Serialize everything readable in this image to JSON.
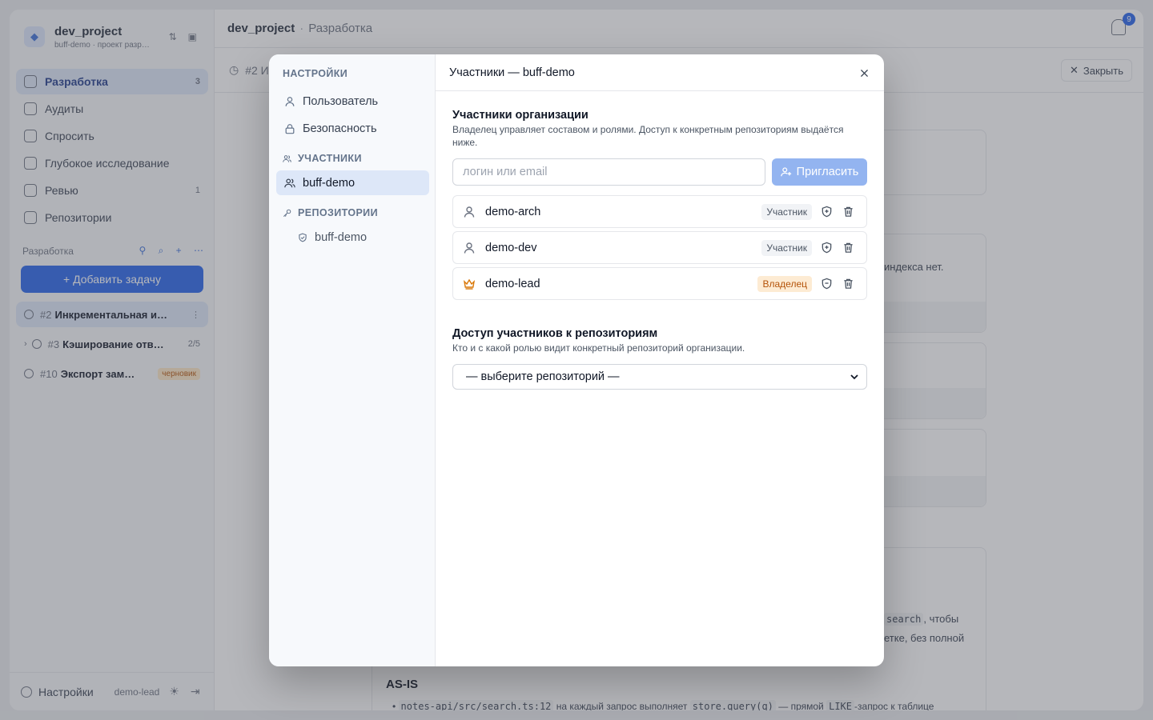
{
  "app": {
    "project_name": "dev_project",
    "project_sub": "buff-demo · проект разр…",
    "nav": [
      {
        "label": "Разработка",
        "count": "3"
      },
      {
        "label": "Аудиты",
        "count": ""
      },
      {
        "label": "Спросить",
        "count": ""
      },
      {
        "label": "Глубокое исследование",
        "count": ""
      },
      {
        "label": "Ревью",
        "count": "1"
      },
      {
        "label": "Репозитории",
        "count": ""
      }
    ],
    "section_label": "Разработка",
    "add_task_label": "+ Добавить задачу",
    "tasks": [
      {
        "num": "#2",
        "title": "Инкрементальная и…",
        "meta": ""
      },
      {
        "num": "#3",
        "title": "Кэширование отв…",
        "meta": "2/5"
      },
      {
        "num": "#10",
        "title": "Экспорт зам…",
        "meta": "черновик"
      }
    ],
    "footer_settings": "Настройки",
    "footer_user": "demo-lead",
    "breadcrumb_project": "dev_project",
    "breadcrumb_sep": "·",
    "breadcrumb_section": "Разработка",
    "notifications_count": "9",
    "task_header": "#2 И",
    "close_label": "Закрыть",
    "bg_snippet_1": "индекса нет.",
    "bg_snippet_2": "search",
    "bg_snippet_2b": ", чтобы",
    "bg_snippet_3": "етке, без полной",
    "bg_heading": "AS-IS",
    "bg_bullet_code": "notes-api/src/search.ts:12",
    "bg_bullet_text1": "на каждый запрос выполняет",
    "bg_bullet_code2": "store.query(q)",
    "bg_bullet_text2": "— прямой",
    "bg_bullet_code3": "LIKE",
    "bg_bullet_text3": "-запрос к таблице"
  },
  "modal": {
    "sidebar": {
      "settings_header": "НАСТРОЙКИ",
      "user_label": "Пользователь",
      "security_label": "Безопасность",
      "members_header": "УЧАСТНИКИ",
      "members_org": "buff-demo",
      "repos_header": "РЕПОЗИТОРИИ",
      "repos_item": "buff-demo"
    },
    "title": "Участники — buff-demo",
    "org_members_title": "Участники организации",
    "org_members_desc": "Владелец управляет составом и ролями. Доступ к конкретным репозиториям выдаётся ниже.",
    "invite_placeholder": "логин или email",
    "invite_value": "",
    "invite_button": "Пригласить",
    "members": [
      {
        "name": "demo-arch",
        "role": "Участник",
        "is_owner": false
      },
      {
        "name": "demo-dev",
        "role": "Участник",
        "is_owner": false
      },
      {
        "name": "demo-lead",
        "role": "Владелец",
        "is_owner": true
      }
    ],
    "repo_access_title": "Доступ участников к репозиториям",
    "repo_access_desc": "Кто и с какой ролью видит конкретный репозиторий организации.",
    "repo_select_value": "— выберите репозиторий —"
  },
  "colors": {
    "accent": "#2563eb",
    "invite_disabled": "#93b4f0",
    "owner": "#d97706",
    "overlay": "rgba(80,84,92,0.42)"
  }
}
